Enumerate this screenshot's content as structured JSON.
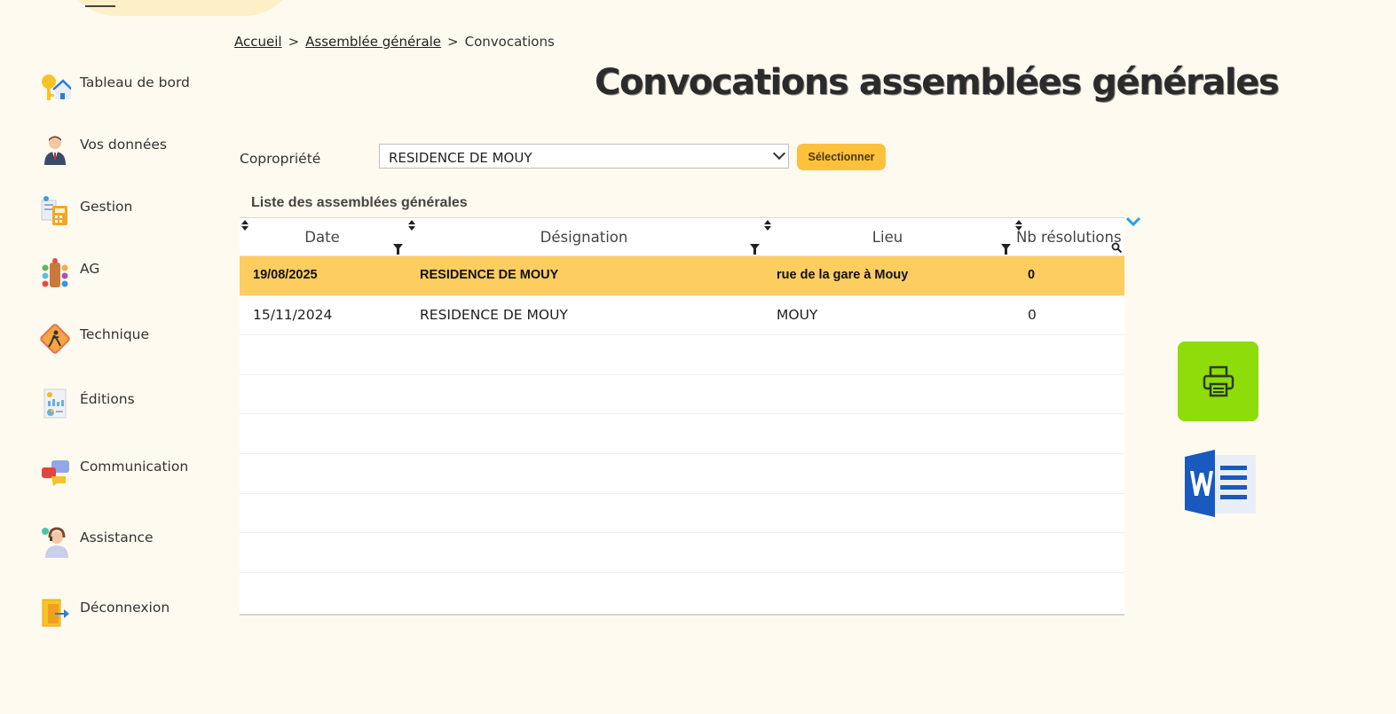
{
  "breadcrumb": {
    "home": "Accueil",
    "section": "Assemblée générale",
    "current": "Convocations",
    "separator": ">"
  },
  "page_title": "Convocations assemblées générales",
  "sidebar": {
    "items": [
      {
        "label": "Tableau de bord",
        "icon": "dashboard-key-house-icon"
      },
      {
        "label": "Vos données",
        "icon": "user-profile-icon"
      },
      {
        "label": "Gestion",
        "icon": "calculator-documents-icon"
      },
      {
        "label": "AG",
        "icon": "meeting-table-icon"
      },
      {
        "label": "Technique",
        "icon": "worker-sign-icon"
      },
      {
        "label": "Éditions",
        "icon": "report-document-icon"
      },
      {
        "label": "Communication",
        "icon": "chat-bubbles-icon"
      },
      {
        "label": "Assistance",
        "icon": "support-agent-icon"
      },
      {
        "label": "Déconnexion",
        "icon": "logout-door-icon"
      }
    ]
  },
  "filter": {
    "label": "Copropriété",
    "selected": "RESIDENCE DE MOUY",
    "button_label": "Sélectionner"
  },
  "grid": {
    "caption": "Liste des assemblées générales",
    "columns": [
      "Date",
      "Désignation",
      "Lieu",
      "Nb résolutions"
    ],
    "rows": [
      {
        "date": "19/08/2025",
        "designation": "RESIDENCE DE MOUY",
        "lieu": "rue de la gare à Mouy",
        "nb_resolutions": "0",
        "selected": true
      },
      {
        "date": "15/11/2024",
        "designation": "RESIDENCE DE MOUY",
        "lieu": "MOUY",
        "nb_resolutions": "0",
        "selected": false
      }
    ],
    "empty_rows": 7
  },
  "actions": {
    "print_icon": "printer-icon",
    "word_icon": "word-document-icon"
  },
  "colors": {
    "background": "#fffaf0",
    "accent": "#ffc13b",
    "selected_row": "#fdcd5f",
    "print_button": "#8edc0a",
    "word_blue": "#185abd"
  }
}
